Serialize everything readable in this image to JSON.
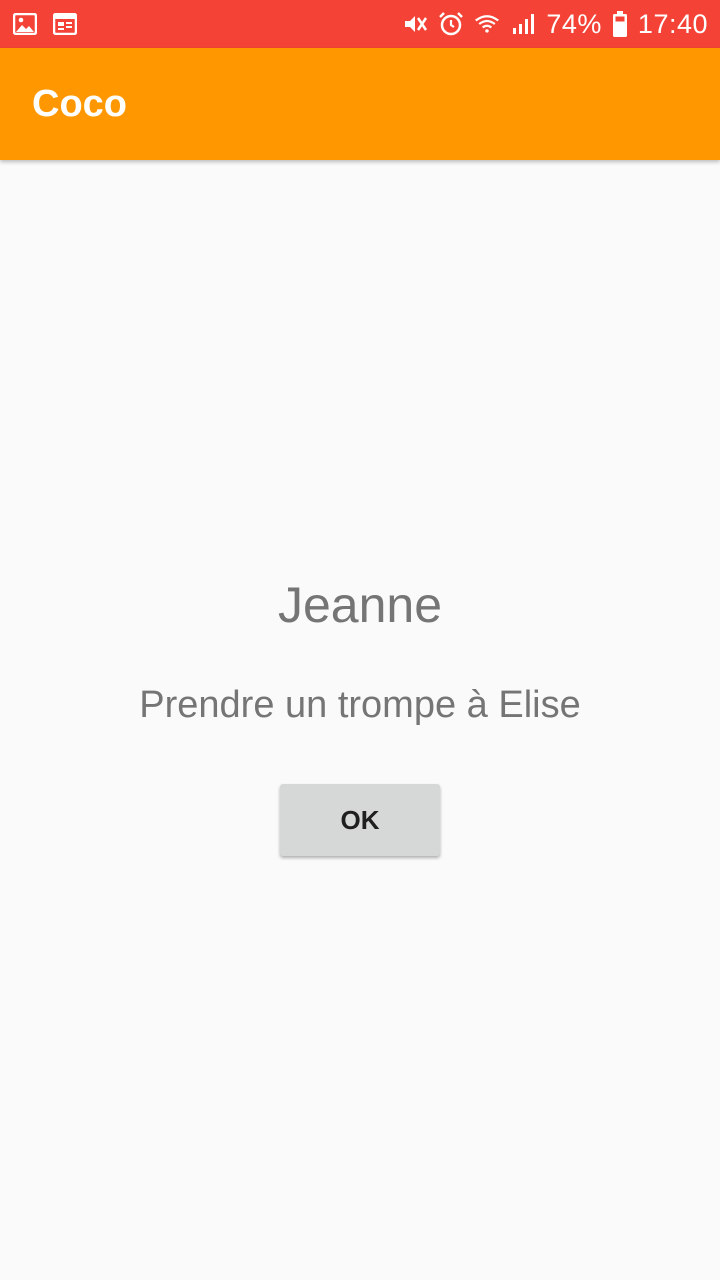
{
  "status_bar": {
    "background_color": "#f44336",
    "left_icons": [
      "image-notification-icon",
      "calendar-notification-icon"
    ],
    "right_icons": [
      "mute-vibrate-icon",
      "alarm-icon",
      "wifi-icon",
      "signal-icon",
      "battery-icon"
    ],
    "battery_percent": "74%",
    "time": "17:40"
  },
  "app_bar": {
    "title": "Coco",
    "background_color": "#ff9800"
  },
  "content": {
    "name": "Jeanne",
    "message": "Prendre un trompe à Elise",
    "ok_label": "OK"
  }
}
